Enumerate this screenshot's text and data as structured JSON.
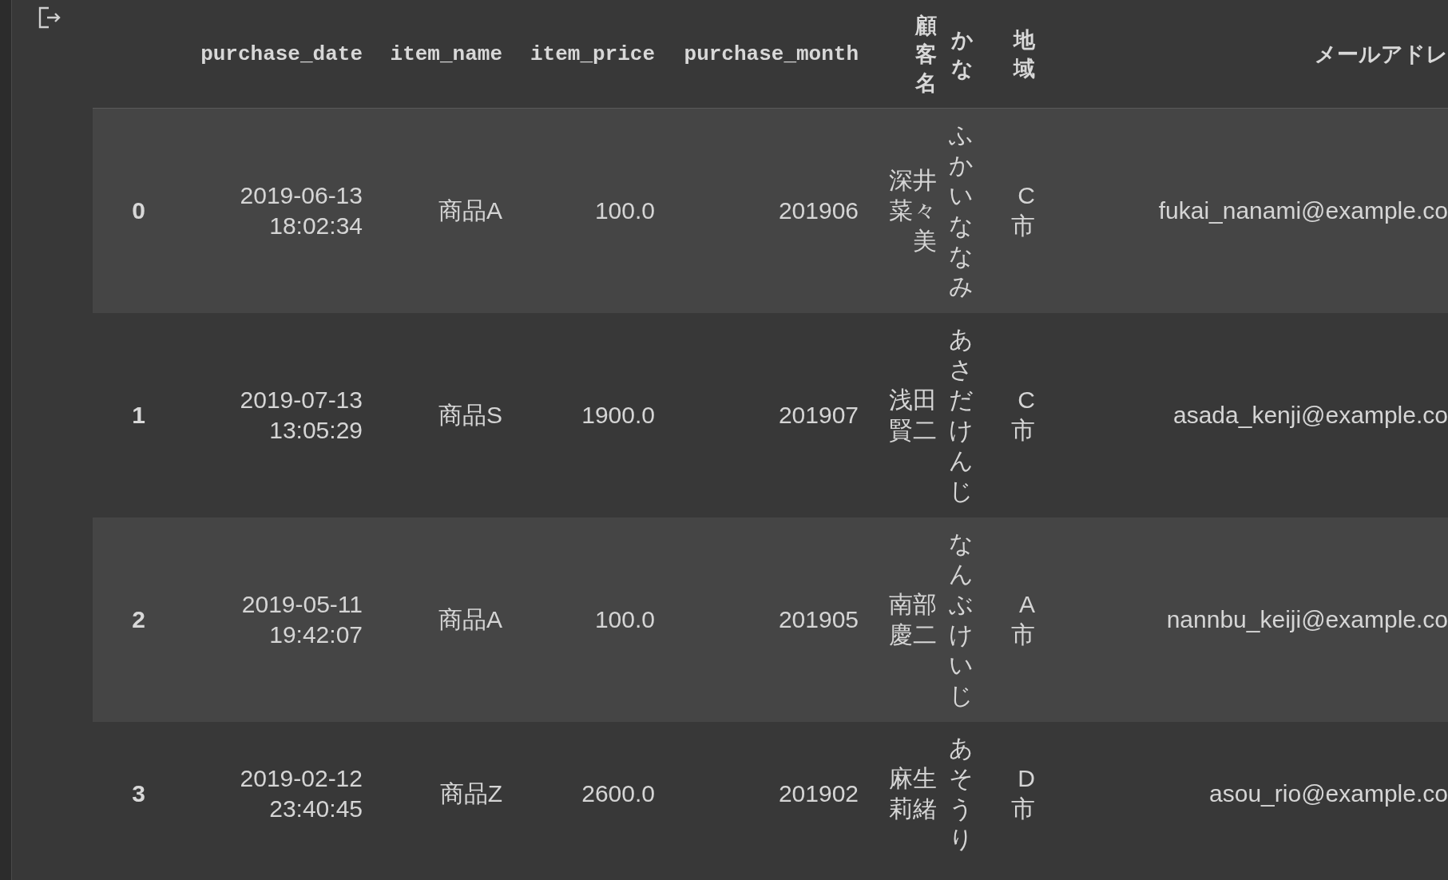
{
  "table": {
    "columns": [
      "purchase_date",
      "item_name",
      "item_price",
      "purchase_month",
      "顧客名",
      "かな",
      "地域",
      "メールアドレ"
    ],
    "rows": [
      {
        "index": "0",
        "cells": [
          "2019-06-13 18:02:34",
          "商品A",
          "100.0",
          "201906",
          "深井菜々美",
          "ふかいななみ",
          "C市",
          "fukai_nanami@example.co"
        ]
      },
      {
        "index": "1",
        "cells": [
          "2019-07-13 13:05:29",
          "商品S",
          "1900.0",
          "201907",
          "浅田賢二",
          "あさだけんじ",
          "C市",
          "asada_kenji@example.co"
        ]
      },
      {
        "index": "2",
        "cells": [
          "2019-05-11 19:42:07",
          "商品A",
          "100.0",
          "201905",
          "南部慶二",
          "なんぶけいじ",
          "A市",
          "nannbu_keiji@example.co"
        ]
      },
      {
        "index": "3",
        "cells": [
          "2019-02-12 23:40:45",
          "商品Z",
          "2600.0",
          "201902",
          "麻生莉緒",
          "あそうり",
          "D市",
          "asou_rio@example.co"
        ]
      }
    ]
  }
}
